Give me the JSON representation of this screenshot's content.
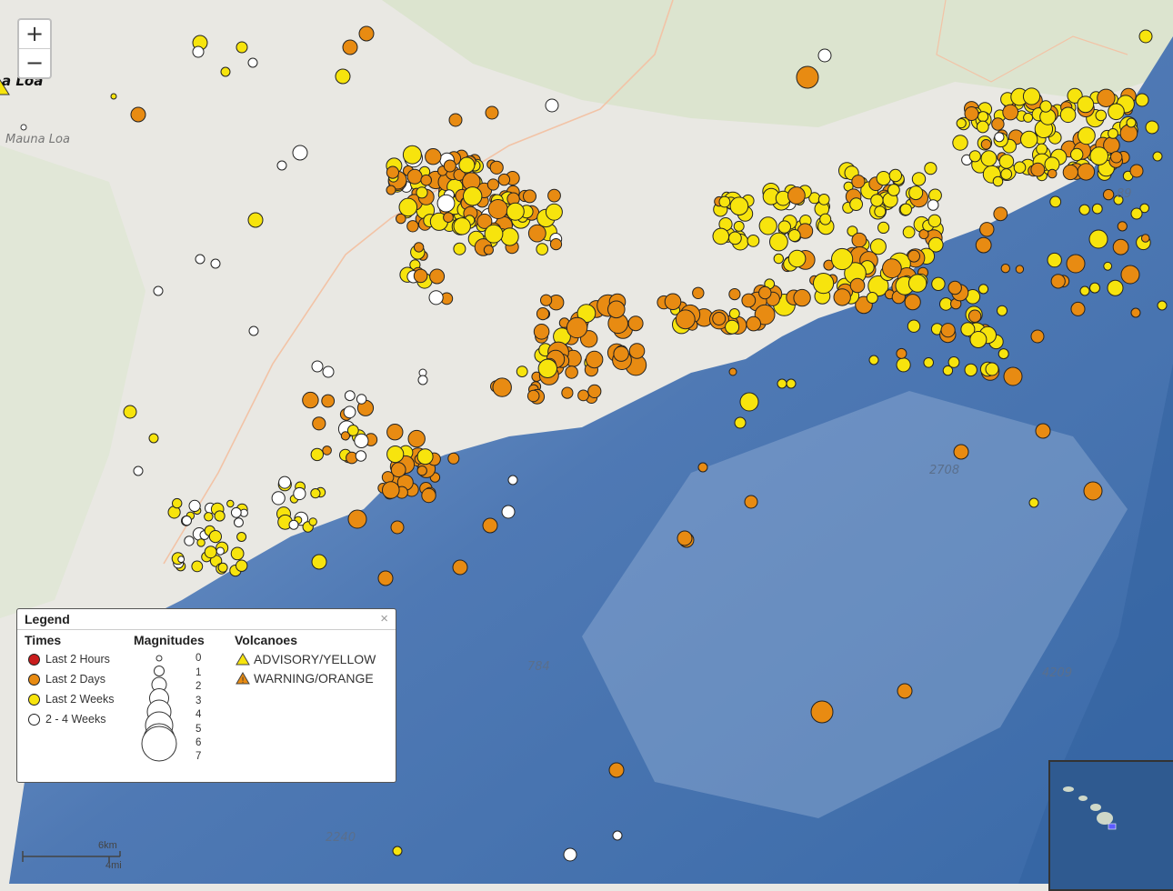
{
  "zoom": {
    "in_label": "+",
    "out_label": "−"
  },
  "map_labels": [
    {
      "id": "mauna-loa-peak",
      "text": "a Loa"
    },
    {
      "id": "mauna-loa",
      "text": "Mauna Loa"
    },
    {
      "id": "depth-2708",
      "text": "2708"
    },
    {
      "id": "depth-784",
      "text": "784"
    },
    {
      "id": "depth-4209",
      "text": "4209"
    },
    {
      "id": "depth-2240",
      "text": "2240"
    },
    {
      "id": "depth-89",
      "text": "89"
    }
  ],
  "legend": {
    "title": "Legend",
    "close": "×",
    "times_heading": "Times",
    "times": [
      {
        "label": "Last 2 Hours",
        "color": "#c91d1d"
      },
      {
        "label": "Last 2 Days",
        "color": "#e88b12"
      },
      {
        "label": "Last 2 Weeks",
        "color": "#f7e40d"
      },
      {
        "label": "2 - 4 Weeks",
        "color": "#ffffff"
      }
    ],
    "magnitudes_heading": "Magnitudes",
    "magnitudes": [
      "0",
      "1",
      "2",
      "3",
      "4",
      "5",
      "6",
      "7"
    ],
    "volcanoes_heading": "Volcanoes",
    "volcanoes": [
      {
        "label": "ADVISORY/YELLOW",
        "color": "#f7e40d"
      },
      {
        "label": "WARNING/ORANGE",
        "color": "#e88b12"
      }
    ]
  },
  "scale": {
    "km": "6km",
    "mi": "4mi"
  },
  "colors": {
    "orange": "#e88b12",
    "yellow": "#f7e40d",
    "white": "#ffffff",
    "land": "#e9e8e3",
    "ocean": "#4f79b4"
  }
}
